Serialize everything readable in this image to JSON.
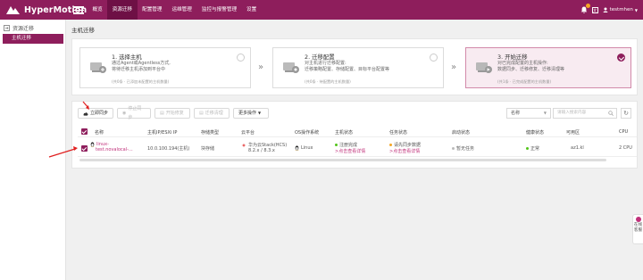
{
  "app": {
    "name": "HyperMotion"
  },
  "nav": {
    "items": [
      {
        "label": "概览",
        "active": false
      },
      {
        "label": "资源迁移",
        "active": true
      },
      {
        "label": "配置管理",
        "active": false
      },
      {
        "label": "运维管理",
        "active": false
      },
      {
        "label": "监控与报警管理",
        "active": false
      },
      {
        "label": "设置",
        "active": false
      }
    ]
  },
  "topright": {
    "user": "testmhen",
    "lang_icon": "language-icon"
  },
  "sidebar": {
    "section": "资源迁移",
    "items": [
      {
        "label": "主机迁移",
        "active": true
      }
    ]
  },
  "page": {
    "title": "主机迁移"
  },
  "steps": [
    {
      "title": "1. 选择主机",
      "desc1": "通过Agent或Agentless方式,",
      "desc2": "将待迁移主机添加到平台中",
      "note": "(共0条 · 已添加未配置的主机数量)",
      "checked": false
    },
    {
      "title": "2. 迁移配置",
      "desc1": "对主机进行迁移配置:",
      "desc2": "迁移策略配置、存储配置、目标平台配置等",
      "note": "(共0条 · 待配置的主机数量)",
      "checked": false
    },
    {
      "title": "3. 开始迁移",
      "desc1": "对已完成配置的主机操作:",
      "desc2": "数据同步、迁移修复、迁移清理等",
      "note": "(共1条 · 已完成配置的主机数量)",
      "checked": true
    }
  ],
  "toolbar": {
    "sync_label": "立即同步",
    "stop_label": "停止同步",
    "start_label": "开始修复",
    "clean_label": "迁移清理",
    "more_label": "更多操作",
    "search_field": "名称",
    "search_placeholder": "请输入搜索内容"
  },
  "table": {
    "columns": [
      "名称",
      "主机IP/ESXi IP",
      "存储类型",
      "云平台",
      "OS操作系统",
      "主机状态",
      "任务状态",
      "启动状态",
      "健康状态",
      "可用区",
      "CPU"
    ],
    "rows": [
      {
        "name1": "linux-",
        "name2": "test.novalocal-...",
        "ip": "10.0.100.194(主机)",
        "storage": "块存储",
        "cloud1": "华为云Stack(HCS)",
        "cloud2": "8.2.x / 8.3.x",
        "os": "Linux",
        "host_status": "注册完成",
        "host_link": ">点击查看详情",
        "task_status": "请先同步数据",
        "task_link": ">点击查看详情",
        "boot_status": "暂无任务",
        "health": "正常",
        "zone": "az1.kl",
        "cpu": "2 CPU"
      }
    ]
  },
  "float_tab": {
    "label1": "在线",
    "label2": "客服"
  },
  "colors": {
    "brand": "#8e1e5c",
    "brand_dark": "#6e1045",
    "link": "#c0307a",
    "ok": "#52c41a",
    "warn": "#f5a623"
  }
}
